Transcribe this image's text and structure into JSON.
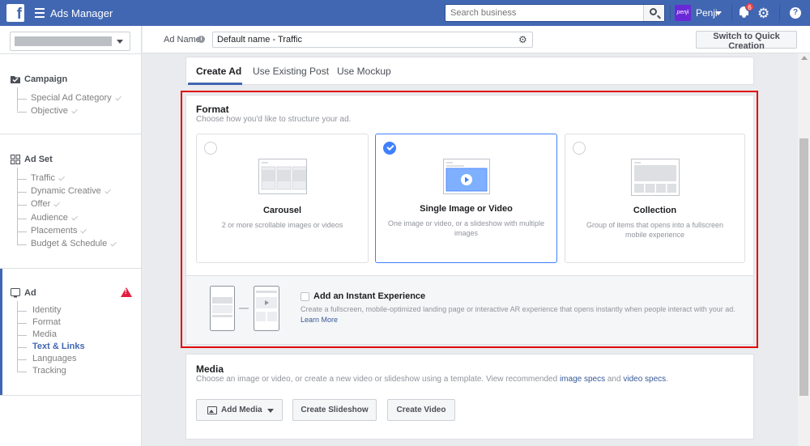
{
  "topbar": {
    "logo_letter": "f",
    "app_title": "Ads Manager",
    "search_placeholder": "Search business",
    "account_badge": "penji",
    "account_name": "Penji",
    "notification_count": "6",
    "gear_glyph": "⚙",
    "help_glyph": "?"
  },
  "sidebar": {
    "campaign": {
      "title": "Campaign",
      "items": [
        "Special Ad Category",
        "Objective"
      ]
    },
    "adset": {
      "title": "Ad Set",
      "items": [
        "Traffic",
        "Dynamic Creative",
        "Offer",
        "Audience",
        "Placements",
        "Budget & Schedule"
      ]
    },
    "ad": {
      "title": "Ad",
      "items": [
        "Identity",
        "Format",
        "Media",
        "Text & Links",
        "Languages",
        "Tracking"
      ],
      "active_item": "Text & Links"
    }
  },
  "header": {
    "ad_name_label": "Ad Name",
    "ad_name_value": "Default name - Traffic",
    "quick_creation_label": "Switch to Quick Creation"
  },
  "tabs": [
    "Create Ad",
    "Use Existing Post",
    "Use Mockup"
  ],
  "format": {
    "heading": "Format",
    "description": "Choose how you'd like to structure your ad.",
    "options": [
      {
        "title": "Carousel",
        "description": "2 or more scrollable images or videos",
        "selected": false,
        "icon": "carousel-icon"
      },
      {
        "title": "Single Image or Video",
        "description": "One image or video, or a slideshow with multiple images",
        "selected": true,
        "icon": "single-image-icon"
      },
      {
        "title": "Collection",
        "description": "Group of items that opens into a fullscreen mobile experience",
        "selected": false,
        "icon": "collection-icon"
      }
    ],
    "instant_experience": {
      "title": "Add an Instant Experience",
      "description": "Create a fullscreen, mobile-optimized landing page or interactive AR experience that opens instantly when people interact with your ad.",
      "link": "Learn More"
    }
  },
  "media": {
    "heading": "Media",
    "description_prefix": "Choose an image or video, or create a new video or slideshow using a template. View recommended ",
    "link_image_specs": "image specs",
    "description_and": " and ",
    "link_video_specs": "video specs",
    "description_suffix": ".",
    "buttons": {
      "add_media": "Add Media",
      "create_slideshow": "Create Slideshow",
      "create_video": "Create Video"
    }
  },
  "colors": {
    "brand_blue": "#4267b2",
    "selected_blue": "#4080ff",
    "highlight_red": "#e00000",
    "warning_red": "#e41e3f"
  }
}
